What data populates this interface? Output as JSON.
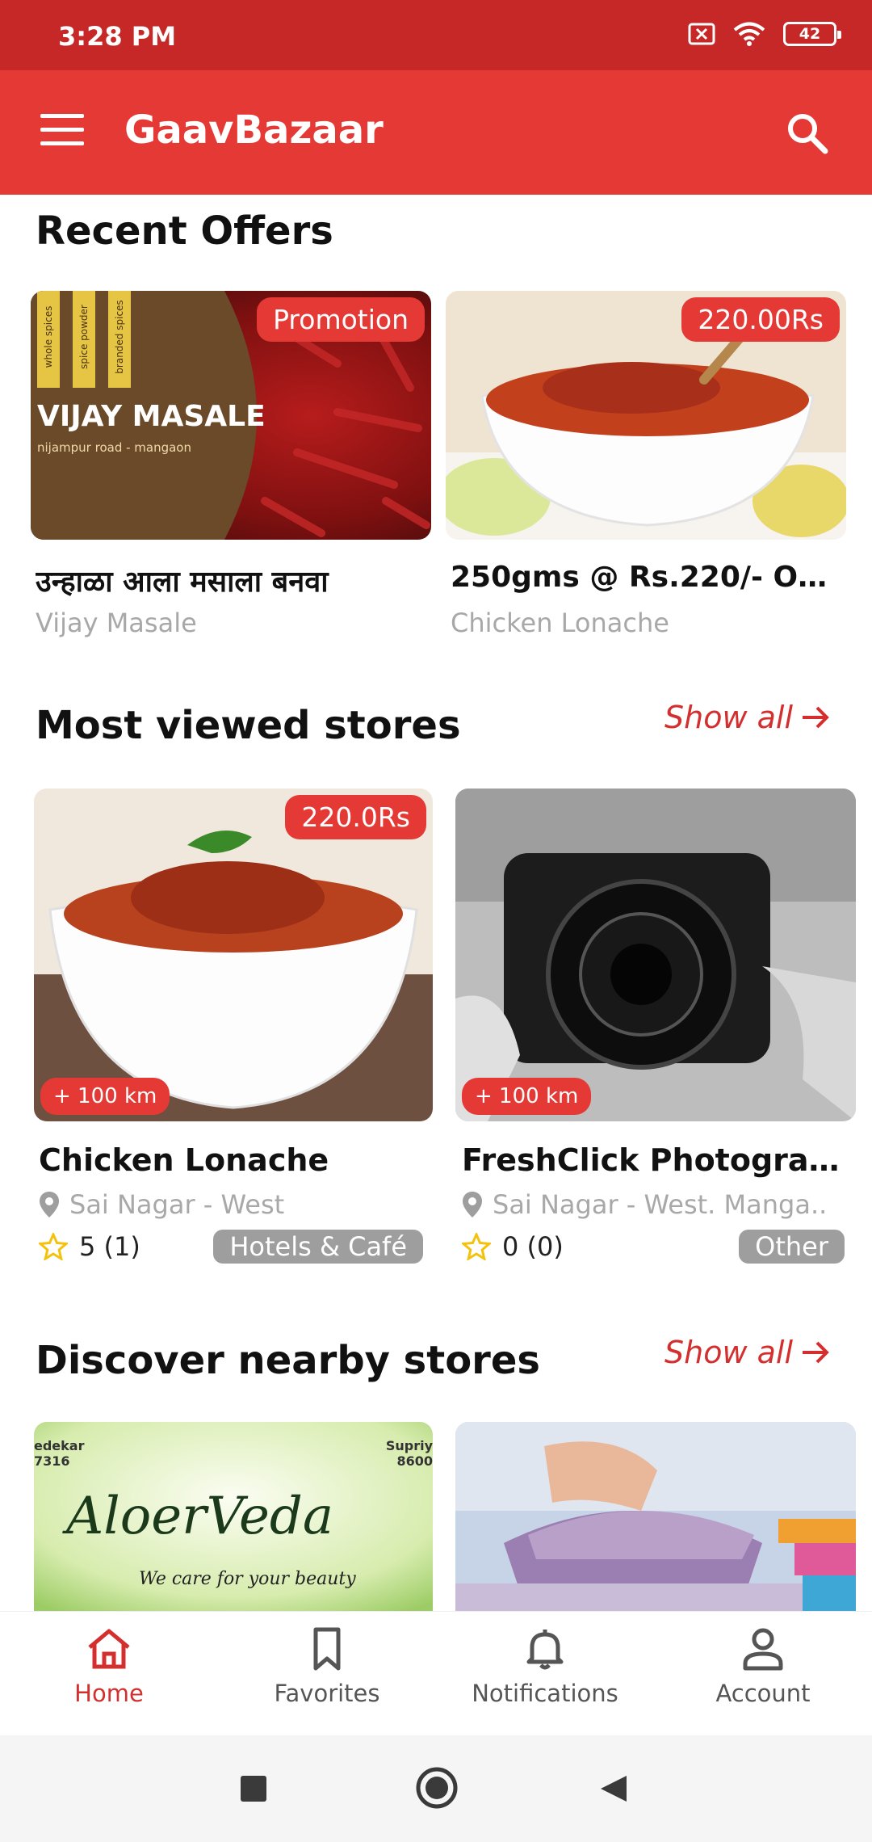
{
  "status_bar": {
    "time": "3:28 PM",
    "battery": "42"
  },
  "app_bar": {
    "title": "GaavBazaar"
  },
  "recent_offers": {
    "title": "Recent Offers",
    "items": [
      {
        "badge": "Promotion",
        "title": "उन्हाळा आला मसाला बनवा",
        "subtitle": "Vijay Masale",
        "image_text": {
          "brand": "VIJAY MASALE",
          "address": "nijampur road - mangaon",
          "tags": [
            "whole spices",
            "spice powder",
            "branded spices"
          ]
        }
      },
      {
        "badge": "220.00Rs",
        "title": "250gms @ Rs.220/- ON...",
        "subtitle": "Chicken Lonache"
      }
    ]
  },
  "most_viewed": {
    "title": "Most viewed stores",
    "show_all": "Show all",
    "items": [
      {
        "badge": "220.0Rs",
        "distance": "+ 100 km",
        "name": "Chicken Lonache",
        "location": "Sai Nagar - West",
        "rating": "5 (1)",
        "category": "Hotels & Café"
      },
      {
        "distance": "+ 100 km",
        "name": "FreshClick Photograp...",
        "location": "Sai Nagar - West. Manga..",
        "rating": "0 (0)",
        "category": "Other"
      }
    ]
  },
  "nearby": {
    "title": "Discover nearby stores",
    "show_all": "Show all",
    "items": [
      {
        "image_text": {
          "logo": "AloerVeda",
          "tagline": "We care for your beauty",
          "corner_left": "edekar 7316",
          "corner_right": "Supriy 8600"
        }
      },
      {}
    ]
  },
  "bottom_nav": {
    "items": [
      "Home",
      "Favorites",
      "Notifications",
      "Account"
    ],
    "active": "Home"
  },
  "colors": {
    "primary": "#e53935",
    "status_bar": "#c62828",
    "accent_text": "#d32f2f"
  }
}
